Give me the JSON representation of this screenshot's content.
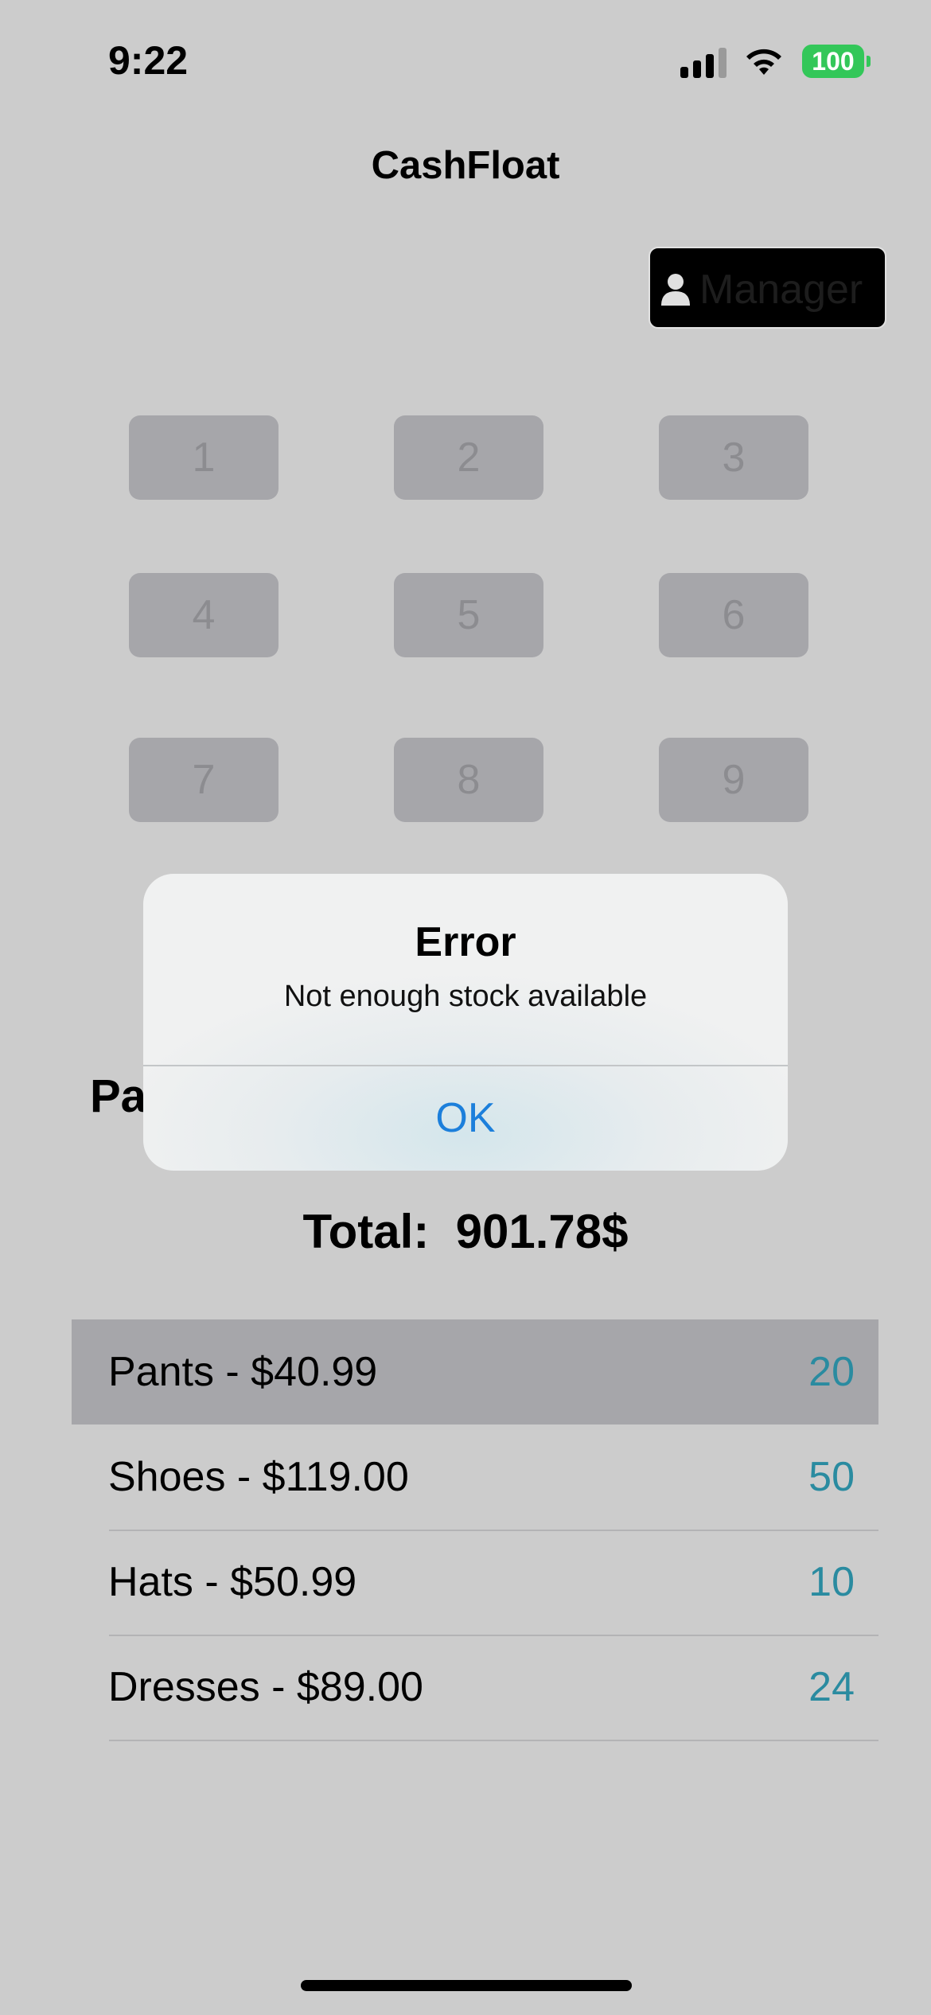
{
  "status_bar": {
    "time": "9:22",
    "battery": "100"
  },
  "app": {
    "title": "CashFloat"
  },
  "manager_button": {
    "label": "Manager",
    "icon": "person-icon"
  },
  "keypad": [
    "1",
    "2",
    "3",
    "4",
    "5",
    "6",
    "7",
    "8",
    "9"
  ],
  "section_title_partial": "Pa",
  "total": {
    "label": "Total:",
    "value": "901.78$"
  },
  "products": [
    {
      "label": "Pants - $40.99",
      "quantity": "20",
      "selected": true
    },
    {
      "label": "Shoes - $119.00",
      "quantity": "50",
      "selected": false
    },
    {
      "label": "Hats - $50.99",
      "quantity": "10",
      "selected": false
    },
    {
      "label": "Dresses - $89.00",
      "quantity": "24",
      "selected": false
    }
  ],
  "alert": {
    "title": "Error",
    "message": "Not enough stock available",
    "ok_label": "OK"
  },
  "colors": {
    "accent": "#1c7fdb",
    "quantity": "#2a8ba0",
    "battery": "#33c759"
  }
}
